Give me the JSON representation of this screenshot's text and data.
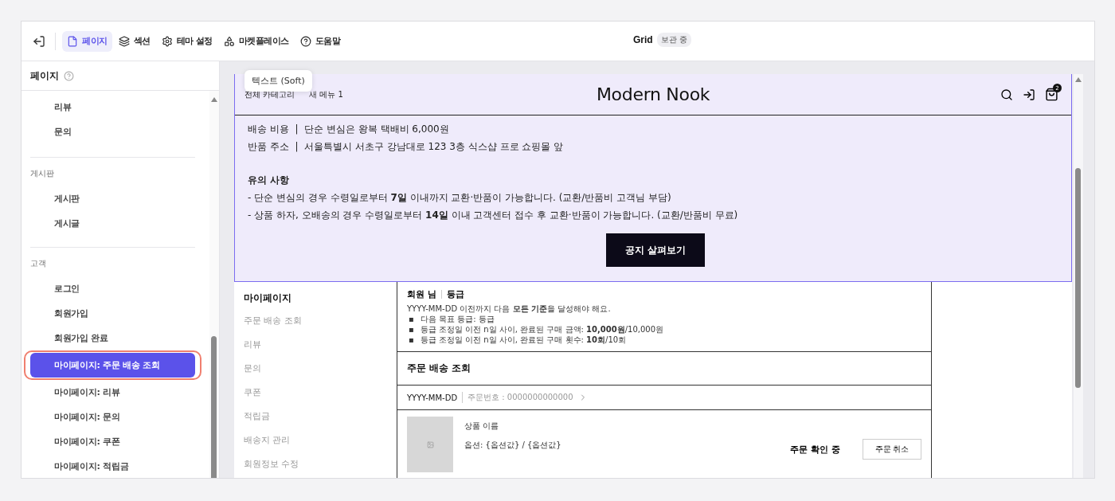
{
  "toolbar": {
    "tabs": [
      {
        "kind": "page",
        "label": "페이지",
        "selected": true
      },
      {
        "kind": "section",
        "label": "섹션",
        "selected": false
      },
      {
        "kind": "theme",
        "label": "테마 설정",
        "selected": false
      },
      {
        "kind": "market",
        "label": "마켓플레이스",
        "selected": false
      },
      {
        "kind": "help",
        "label": "도움말",
        "selected": false
      }
    ],
    "site_name": "Grid",
    "status_badge": "보관 중"
  },
  "sidebar": {
    "title": "페이지",
    "groups": [
      {
        "items": [
          {
            "label": "리뷰",
            "selected": false,
            "highlighted": false
          },
          {
            "label": "문의",
            "selected": false,
            "highlighted": false
          }
        ]
      },
      {
        "label": "게시판",
        "items": [
          {
            "label": "게시판",
            "selected": false,
            "highlighted": false
          },
          {
            "label": "게시글",
            "selected": false,
            "highlighted": false
          }
        ]
      },
      {
        "label": "고객",
        "items": [
          {
            "label": "로그인",
            "selected": false,
            "highlighted": false
          },
          {
            "label": "회원가입",
            "selected": false,
            "highlighted": false
          },
          {
            "label": "회원가입 완료",
            "selected": false,
            "highlighted": false
          },
          {
            "label": "마이페이지: 주문 배송 조회",
            "selected": true,
            "highlighted": true
          },
          {
            "label": "마이페이지: 리뷰",
            "selected": false,
            "highlighted": false
          },
          {
            "label": "마이페이지: 문의",
            "selected": false,
            "highlighted": false
          },
          {
            "label": "마이페이지: 쿠폰",
            "selected": false,
            "highlighted": false
          },
          {
            "label": "마이페이지: 적립금",
            "selected": false,
            "highlighted": false
          }
        ]
      }
    ]
  },
  "preview": {
    "tooltip": "텍스트 (Soft)",
    "header": {
      "menu": [
        "전체 카테고리",
        "새 메뉴 1"
      ],
      "logo": "Modern Nook",
      "cart_count": "2"
    },
    "notice": {
      "selected": true,
      "info": [
        "배송 비용  |  단순 변심은 왕복 택배비 6,000원",
        "반품 주소  |  서울특별시 서초구 강남대로 123 3층 식스샵 프로 쇼핑몰 앞"
      ],
      "heading": "유의 사항",
      "lines": [
        "- 단순 변심의 경우 수령일로부터 **7일** 이내까지 교환·반품이 가능합니다. (교환/반품비 고객님 부담)",
        "- 상품 하자, 오배송의 경우 수령일로부터 **14일** 이내 고객센터 접수 후 교환·반품이 가능합니다. (교환/반품비 무료)"
      ],
      "button": "공지 살펴보기"
    },
    "mypage": {
      "title": "마이페이지",
      "nav": [
        "주문 배송 조회",
        "리뷰",
        "문의",
        "쿠폰",
        "적립금",
        "배송지 관리",
        "회원정보 수정"
      ],
      "grade": {
        "member": "회원 님",
        "grade": "등급",
        "intro": "YYYY-MM-DD 이전까지 다음 **모든 기준**을 달성해야 해요.",
        "bullets": [
          {
            "marker": "▪",
            "text": "다음 목표 등급: 등급"
          },
          {
            "marker": "▪",
            "text": "등급 조정일 이전 n일 사이, 완료된 구매 금액: **10,000원**/10,000원"
          },
          {
            "marker": "▪",
            "text": "등급 조정일 이전 n일 사이, 완료된 구매 횟수: **10회**/10회"
          }
        ]
      },
      "orders_title": "주문 배송 조회",
      "order": {
        "date": "YYYY-MM-DD",
        "number": "주문번호 : 0000000000000",
        "product": "상품 이름",
        "option": "옵션: {옵션값} / {옵션값}",
        "status": "주문 확인 중",
        "action": "주문 취소"
      }
    }
  }
}
